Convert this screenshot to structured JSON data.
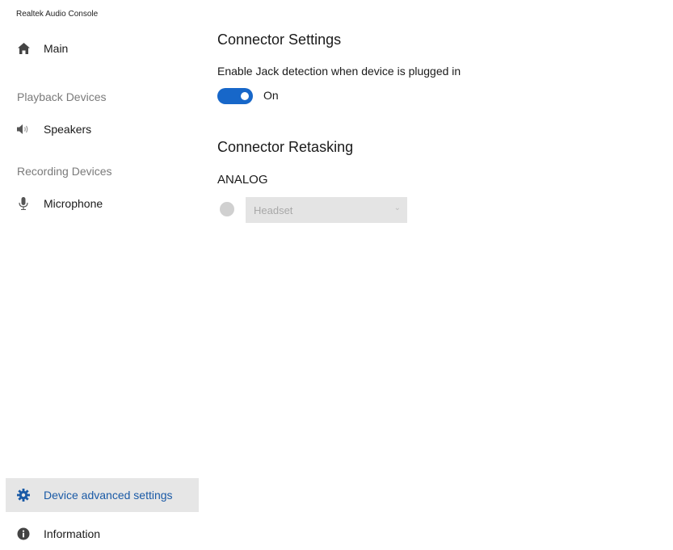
{
  "app": {
    "title": "Realtek Audio Console"
  },
  "sidebar": {
    "main_label": "Main",
    "playback_section": "Playback Devices",
    "playback_items": [
      {
        "label": "Speakers",
        "icon": "speaker-icon"
      }
    ],
    "recording_section": "Recording Devices",
    "recording_items": [
      {
        "label": "Microphone",
        "icon": "microphone-icon"
      }
    ],
    "bottom_items": [
      {
        "label": "Device advanced settings",
        "icon": "gear-icon",
        "selected": true
      },
      {
        "label": "Information",
        "icon": "info-icon",
        "selected": false
      }
    ]
  },
  "main": {
    "connector_settings": {
      "heading": "Connector Settings",
      "jack_detection_label": "Enable Jack detection when device is plugged in",
      "jack_detection_on": true,
      "jack_detection_state": "On"
    },
    "connector_retasking": {
      "heading": "Connector Retasking",
      "group_label": "ANALOG",
      "selected_device": "Headset",
      "disabled": true
    }
  },
  "colors": {
    "accent": "#1767c9",
    "selected_text": "#1a5aa6",
    "selected_bg": "#e6e6e6",
    "section_label": "#7a7a7a"
  }
}
